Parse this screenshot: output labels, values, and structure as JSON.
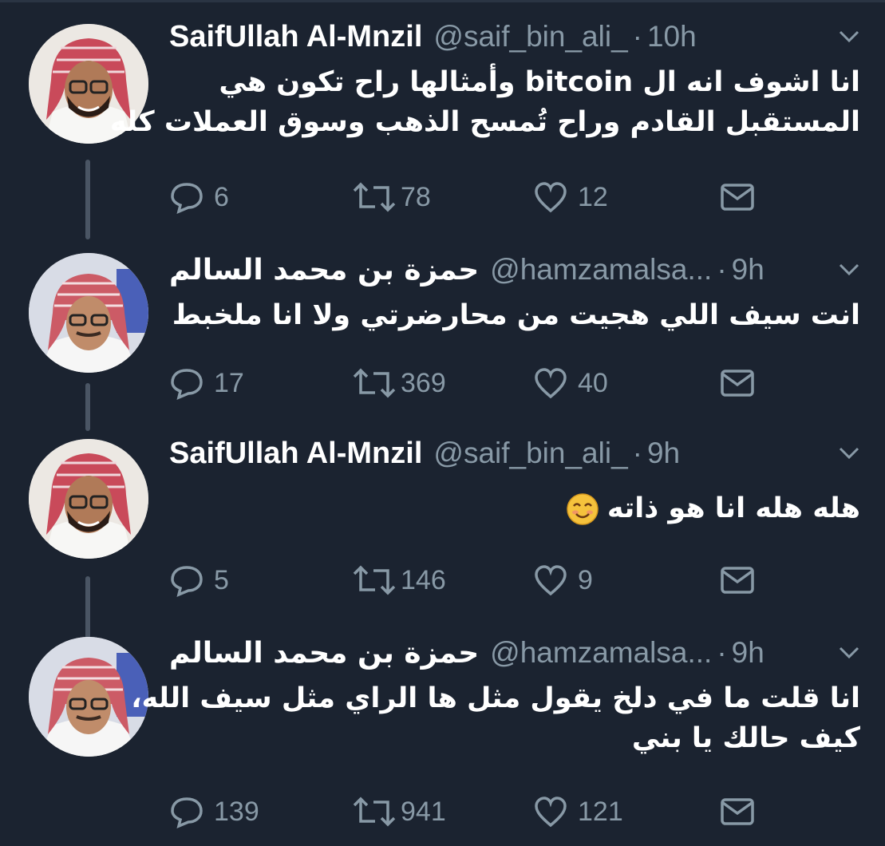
{
  "tweets": [
    {
      "name": "SaifUllah Al-Mnzil",
      "handle": "@saif_bin_ali_",
      "time": "10h",
      "text_lines": [
        "انا اشوف انه ال bitcoin وأمثالها راح تكون هي",
        "المستقبل القادم وراح تُمسح الذهب وسوق العملات كله"
      ],
      "replies": "6",
      "retweets": "78",
      "likes": "12"
    },
    {
      "name": "حمزة بن محمد السالم",
      "handle": "@hamzamalsa...",
      "time": "9h",
      "text_lines": [
        "انت سيف اللي هجيت من محارضرتي ولا انا ملخبط"
      ],
      "replies": "17",
      "retweets": "369",
      "likes": "40"
    },
    {
      "name": "SaifUllah Al-Mnzil",
      "handle": "@saif_bin_ali_",
      "time": "9h",
      "text_lines": [
        "هله هله انا هو ذاته"
      ],
      "emoji": "smiling-face",
      "replies": "5",
      "retweets": "146",
      "likes": "9"
    },
    {
      "name": "حمزة بن محمد السالم",
      "handle": "@hamzamalsa...",
      "time": "9h",
      "text_lines": [
        "انا قلت ما في دلخ يقول مثل ها الراي مثل سيف الله،",
        "كيف حالك يا بني"
      ],
      "replies": "139",
      "retweets": "941",
      "likes": "121"
    }
  ],
  "separator": "·",
  "icons": {
    "reply": "reply-icon",
    "retweet": "retweet-icon",
    "like": "heart-icon",
    "dm": "envelope-icon",
    "caret": "chevron-down-icon"
  },
  "colors": {
    "background": "#1b2330",
    "text": "#ffffff",
    "muted": "#8899a6",
    "thread_line": "#4a5564"
  }
}
